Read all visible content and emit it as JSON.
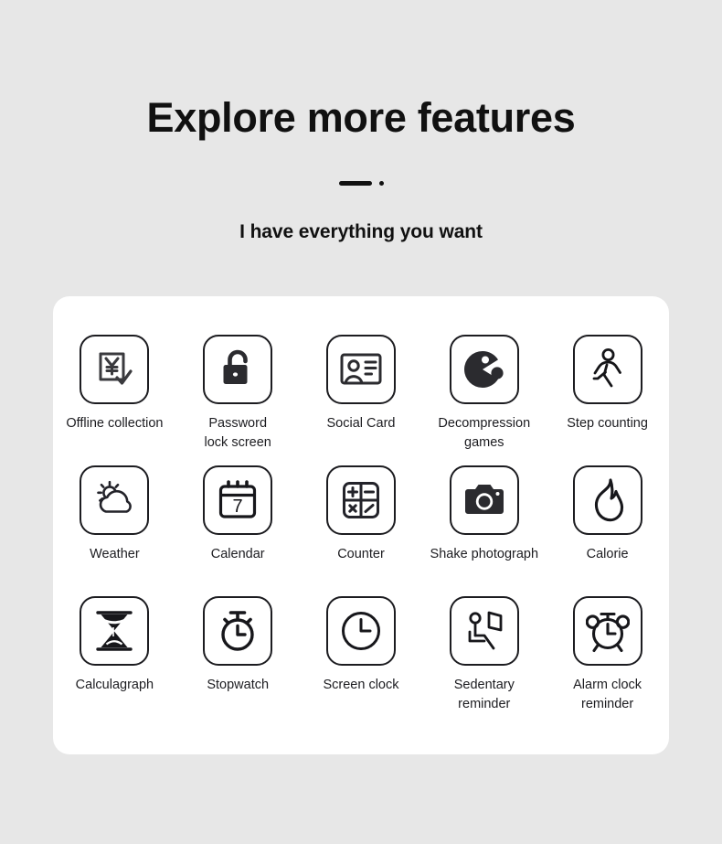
{
  "header": {
    "title": "Explore more features",
    "subtitle": "I have everything you want",
    "divider_dash": "dash",
    "divider_dot": "dot"
  },
  "colors": {
    "background": "#e7e7e7",
    "card": "#ffffff",
    "ink": "#1c1c20",
    "title": "#111111"
  },
  "features": [
    {
      "label": "Offline collection",
      "icon": "receipt-yen-check-icon"
    },
    {
      "label": "Password\nlock screen",
      "icon": "open-padlock-icon"
    },
    {
      "label": "Social Card",
      "icon": "id-card-icon"
    },
    {
      "label": "Decompression\ngames",
      "icon": "pacman-game-icon"
    },
    {
      "label": "Step counting",
      "icon": "walking-person-icon"
    },
    {
      "label": "Weather",
      "icon": "sun-cloud-icon"
    },
    {
      "label": "Calendar",
      "icon": "calendar-7-icon"
    },
    {
      "label": "Counter",
      "icon": "calculator-icon"
    },
    {
      "label": "Shake photograph",
      "icon": "camera-icon"
    },
    {
      "label": "Calorie",
      "icon": "flame-icon"
    },
    {
      "label": "Calculagraph",
      "icon": "hourglass-icon"
    },
    {
      "label": "Stopwatch",
      "icon": "stopwatch-icon"
    },
    {
      "label": "Screen clock",
      "icon": "clock-icon"
    },
    {
      "label": "Sedentary\nreminder",
      "icon": "seated-person-screen-icon"
    },
    {
      "label": "Alarm clock\nreminder",
      "icon": "alarm-clock-icon"
    }
  ]
}
